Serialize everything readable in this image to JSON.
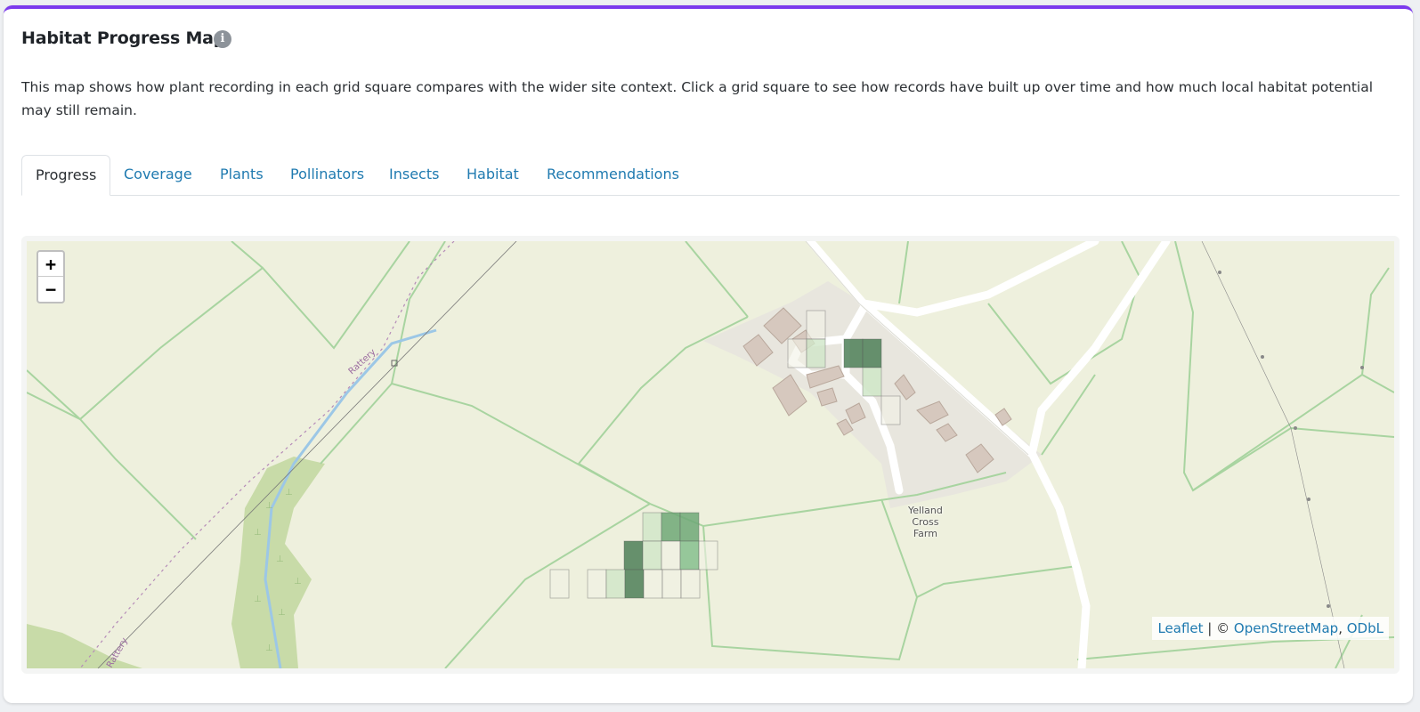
{
  "header": {
    "title": "Habitat Progress Map",
    "info_icon": "info-icon"
  },
  "description": "This map shows how plant recording in each grid square compares with the wider site context. Click a grid square to see how records have built up over time and how much local habitat potential may still remain.",
  "tabs": [
    {
      "label": "Progress",
      "active": true
    },
    {
      "label": "Coverage",
      "active": false
    },
    {
      "label": "Plants",
      "active": false
    },
    {
      "label": "Pollinators",
      "active": false
    },
    {
      "label": "Insects",
      "active": false
    },
    {
      "label": "Habitat",
      "active": false
    },
    {
      "label": "Recommendations",
      "active": false
    }
  ],
  "map": {
    "zoom_in": "+",
    "zoom_out": "−",
    "place_label_lines": [
      "Yelland",
      "Cross",
      "Farm"
    ],
    "path_label": "Rattery",
    "attribution": {
      "leaflet": "Leaflet",
      "separator": " | © ",
      "osm": "OpenStreetMap",
      "odbl": "ODbL"
    },
    "colors": {
      "accent_bar": "#7c3aed",
      "link": "#1f7ab0",
      "land": "#eef0dd",
      "field_lines": "#a8d4a0",
      "stream": "#9cc7e6",
      "woodland": "#c8dba8",
      "grid_dark": "#4e7f58",
      "grid_mid": "#86c08e",
      "grid_light": "#cfe6c8",
      "grid_empty": "#f2f2e6"
    }
  }
}
